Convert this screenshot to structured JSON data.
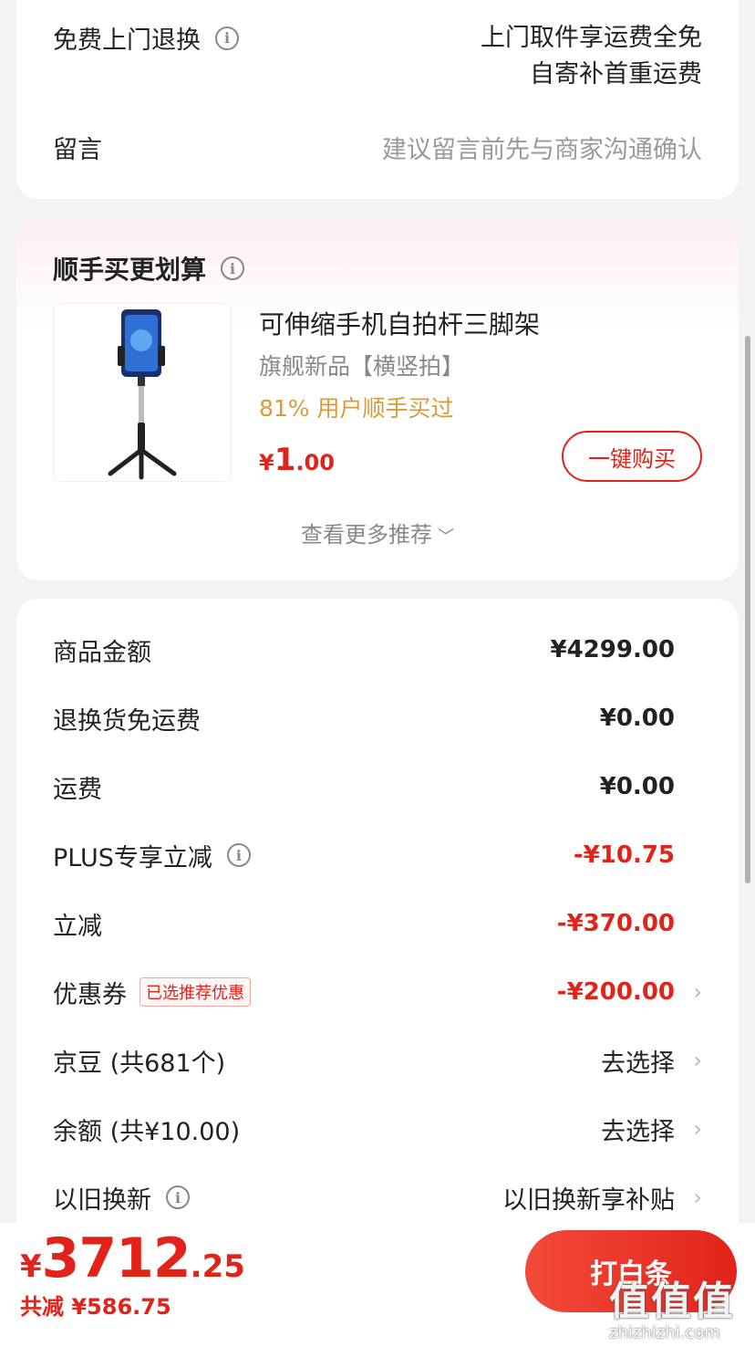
{
  "service": {
    "return_label": "免费上门退换",
    "return_line1": "上门取件享运费全免",
    "return_line2": "自寄补首重运费",
    "message_label": "留言",
    "message_placeholder": "建议留言前先与商家沟通确认"
  },
  "bundle": {
    "title": "顺手买更划算",
    "product_name": "可伸缩手机自拍杆三脚架",
    "product_sub": "旗舰新品【横竖拍】",
    "bought_text": "81% 用户顺手买过",
    "price_currency": "¥",
    "price_int": "1",
    "price_dec": ".00",
    "buy_label": "一键购买",
    "more_label": "查看更多推荐"
  },
  "summary": {
    "rows": [
      {
        "label": "商品金额",
        "value": "¥4299.00"
      },
      {
        "label": "退换货免运费",
        "value": "¥0.00"
      },
      {
        "label": "运费",
        "value": "¥0.00"
      },
      {
        "label": "PLUS专享立减",
        "value": "-¥10.75"
      },
      {
        "label": "立减",
        "value": "-¥370.00"
      },
      {
        "label": "优惠券",
        "tag": "已选推荐优惠",
        "value": "-¥200.00"
      },
      {
        "label": "京豆 (共681个)",
        "value": "去选择"
      },
      {
        "label": "余额 (共¥10.00)",
        "value": "去选择"
      },
      {
        "label": "以旧换新",
        "value": "以旧换新享补贴"
      }
    ]
  },
  "footer": {
    "total_currency": "¥",
    "total_int": "3712",
    "total_dec": ".25",
    "saved": "共减 ¥586.75",
    "submit_label": "打白条",
    "watermark_glyphs": "值值值",
    "watermark_url": "zhizhizhi.com"
  },
  "colors": {
    "accent": "#e2231a",
    "gold": "#d99a3a"
  }
}
